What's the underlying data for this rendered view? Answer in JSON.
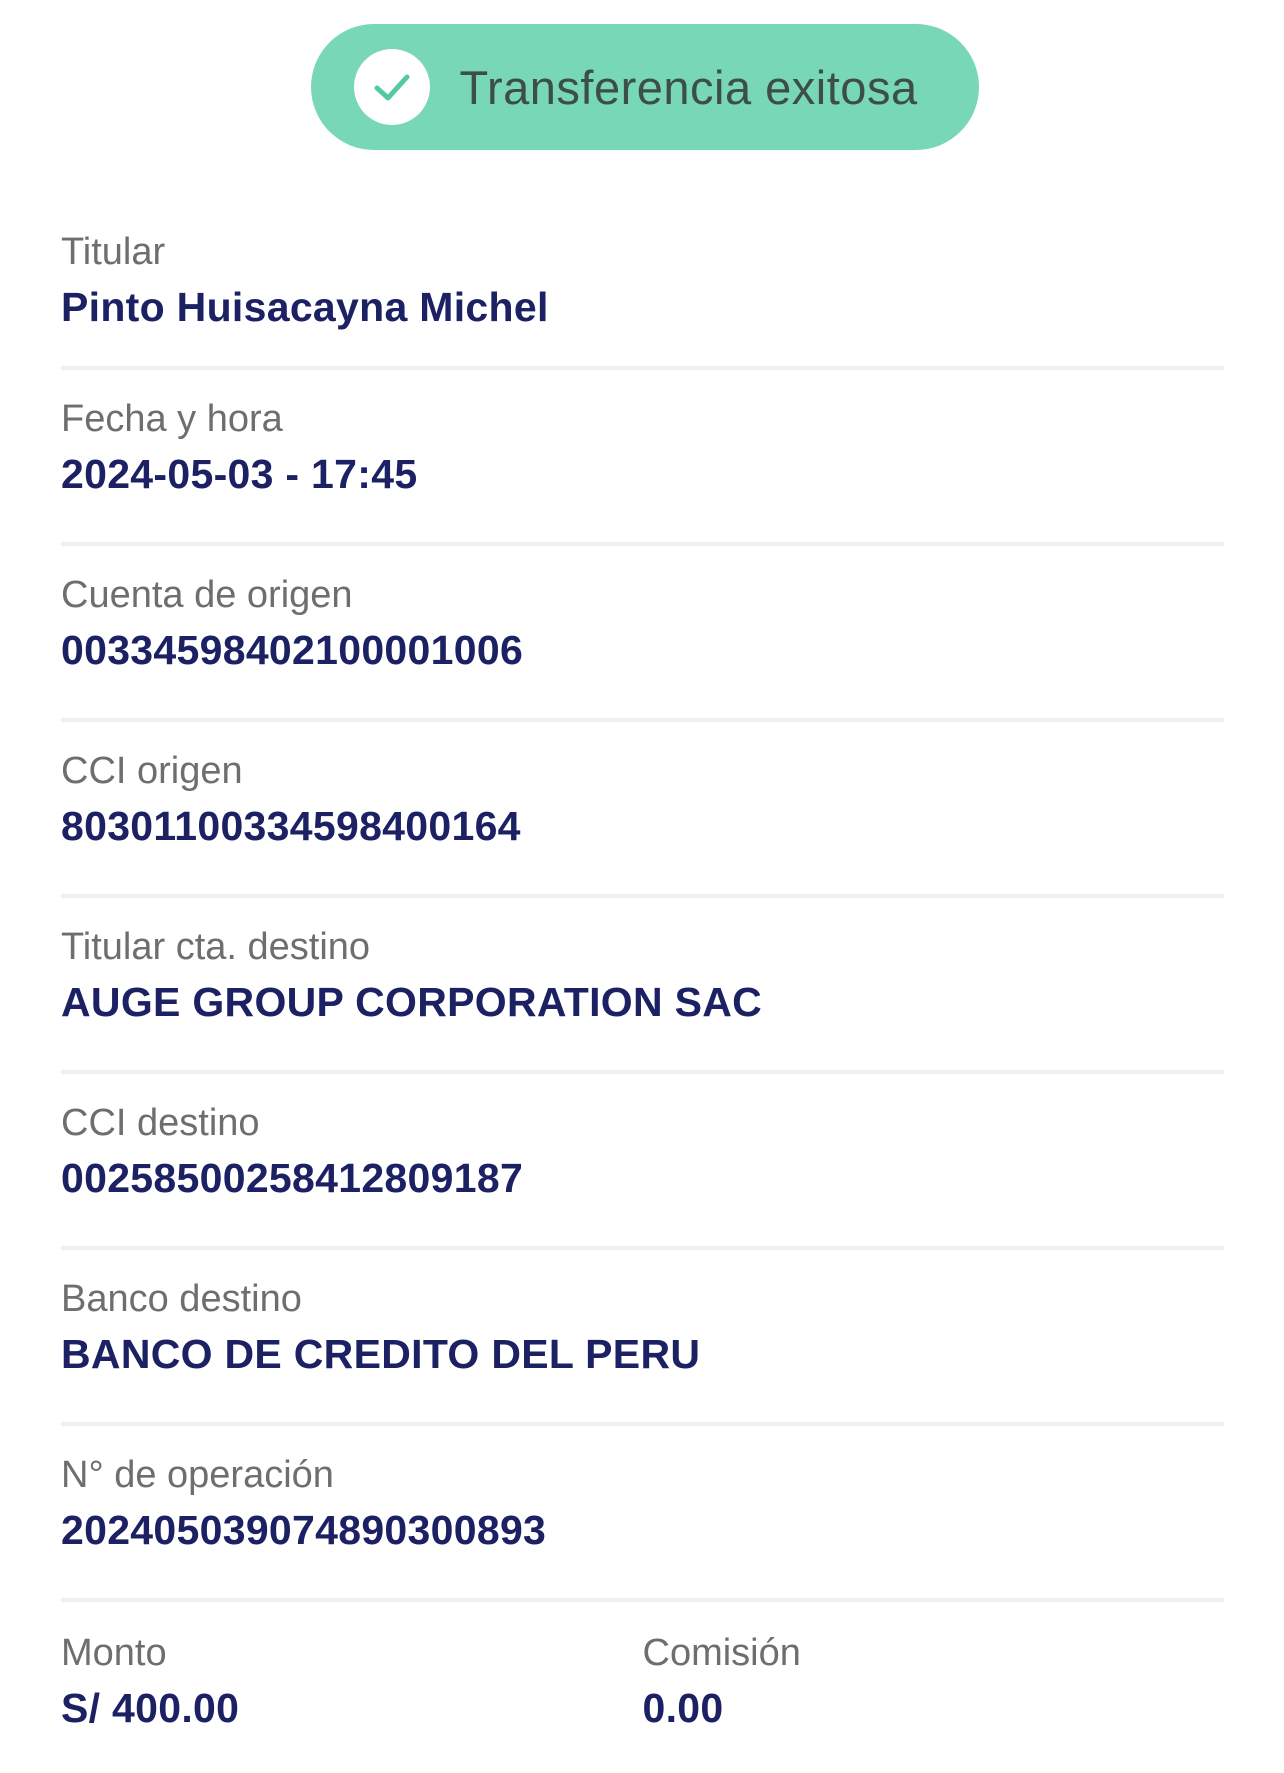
{
  "status": {
    "title": "Transferencia exitosa",
    "color": "#77d7b7"
  },
  "fields": [
    {
      "label": "Titular",
      "value": "Pinto Huisacayna Michel"
    },
    {
      "label": "Fecha y hora",
      "value": "2024-05-03 - 17:45"
    },
    {
      "label": "Cuenta de origen",
      "value": "00334598402100001006"
    },
    {
      "label": "CCI origen",
      "value": "80301100334598400164"
    },
    {
      "label": "Titular cta. destino",
      "value": "AUGE GROUP CORPORATION SAC"
    },
    {
      "label": "CCI destino",
      "value": "00258500258412809187"
    },
    {
      "label": "Banco destino",
      "value": "BANCO DE CREDITO DEL PERU"
    },
    {
      "label": "N° de operación",
      "value": "20240503907489030089​3"
    }
  ],
  "amount": {
    "label": "Monto",
    "value": "S/ 400.00"
  },
  "commission": {
    "label": "Comisión",
    "value": "0.00"
  },
  "colors": {
    "label": "#6e6e6e",
    "value": "#1c2163",
    "divider": "#eef0f4",
    "check": "#55c9a2"
  },
  "icons": {
    "status": "check-icon"
  }
}
